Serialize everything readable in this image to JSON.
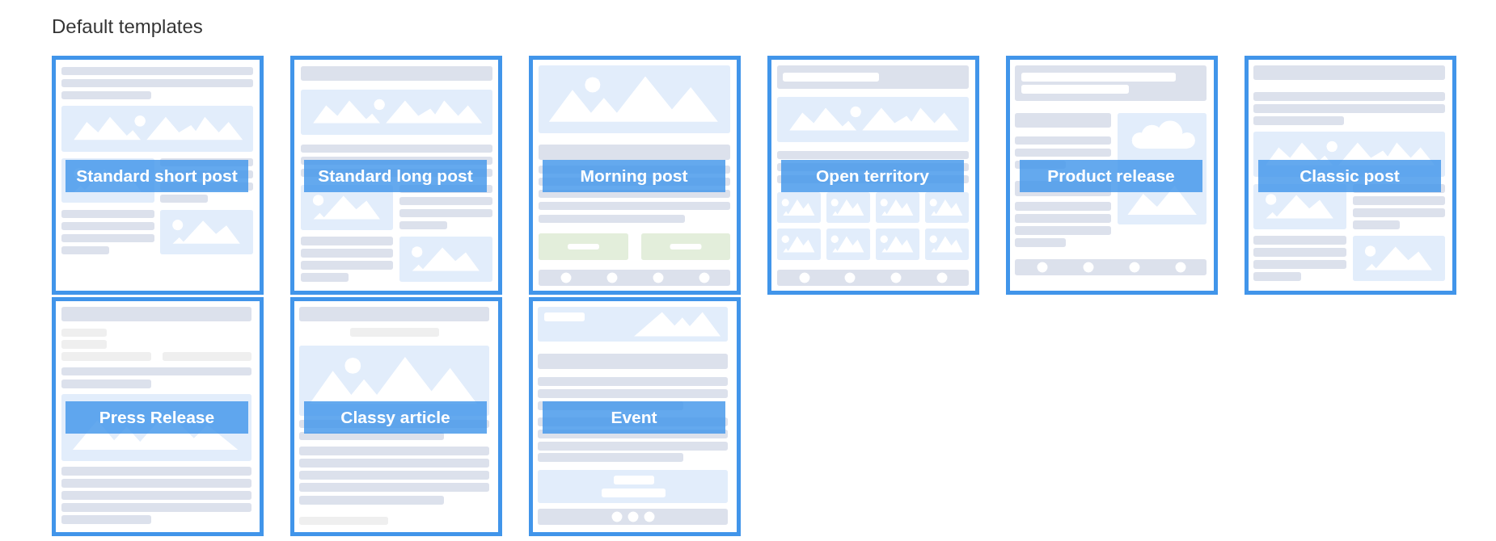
{
  "heading": "Default templates",
  "templates": [
    {
      "name": "Standard short post",
      "kind": "standard-short"
    },
    {
      "name": "Standard long post",
      "kind": "standard-long"
    },
    {
      "name": "Morning post",
      "kind": "morning"
    },
    {
      "name": "Open territory",
      "kind": "open-territory"
    },
    {
      "name": "Product release",
      "kind": "product-release"
    },
    {
      "name": "Classic post",
      "kind": "classic"
    },
    {
      "name": "Press Release",
      "kind": "press-release"
    },
    {
      "name": "Classy article",
      "kind": "classy-article"
    },
    {
      "name": "Event",
      "kind": "event"
    }
  ]
}
